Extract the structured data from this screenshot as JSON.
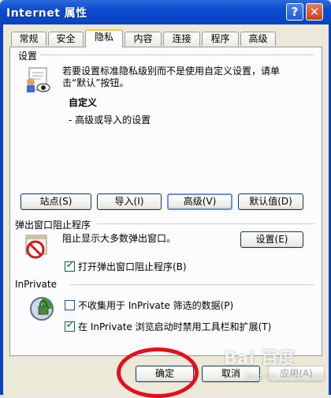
{
  "window": {
    "title": "Internet 属性",
    "help": "?",
    "close": "✕"
  },
  "tabs": [
    {
      "label": "常规"
    },
    {
      "label": "安全"
    },
    {
      "label": "隐私"
    },
    {
      "label": "内容"
    },
    {
      "label": "连接"
    },
    {
      "label": "程序"
    },
    {
      "label": "高级"
    }
  ],
  "settings": {
    "group_label": "设置",
    "description_line1": "若要设置标准隐私级别而不是使用自定义设置，请单",
    "description_line2": "击“默认”按钮。",
    "level": "自定义",
    "level_detail": "- 高级或导入的设置",
    "buttons": {
      "sites": "站点(S)",
      "import": "导入(I)",
      "advanced": "高级(V)",
      "default": "默认值(D)"
    }
  },
  "popup": {
    "group_label": "弹出窗口阻止程序",
    "description": "阻止显示大多数弹出窗口。",
    "settings_button": "设置(E)",
    "checkbox_label": "打开弹出窗口阻止程序(B)",
    "checkbox_checked": true
  },
  "inprivate": {
    "group_label": "InPrivate",
    "checkbox1_label": "不收集用于 InPrivate 筛选的数据(P)",
    "checkbox1_checked": false,
    "checkbox2_label": "在 InPrivate 浏览启动时禁用工具栏和扩展(T)",
    "checkbox2_checked": true
  },
  "footer": {
    "ok": "确定",
    "cancel": "取消",
    "apply": "应用(A)"
  },
  "watermark": {
    "text": "Bai 百度",
    "sub": "jingyan.baidu.com"
  },
  "colors": {
    "title_bar": "#0a43c0",
    "annotation": "#e2101c",
    "tab_highlight": "#ffc83c"
  }
}
